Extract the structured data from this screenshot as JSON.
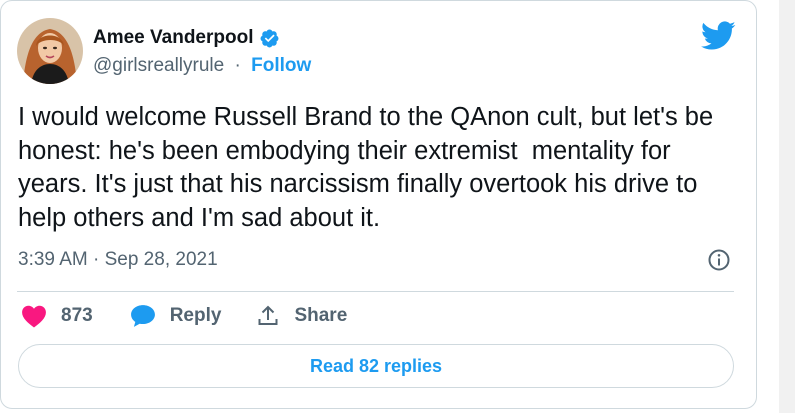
{
  "author": {
    "name": "Amee Vanderpool",
    "handle": "@girlsreallyrule",
    "separator": "·",
    "follow_label": "Follow",
    "verified": true
  },
  "tweet": {
    "text": "I would welcome Russell Brand to the QAnon cult, but let's be honest: he's been embodying their extremist  mentality for years. It's just that his narcissism finally overtook his drive to help others and I'm sad about it.",
    "timestamp": "3:39 AM · Sep 28, 2021"
  },
  "actions": {
    "like_count": "873",
    "reply_label": "Reply",
    "share_label": "Share"
  },
  "read_replies_label": "Read 82 replies",
  "icons": {
    "brand": "twitter-bird-icon",
    "verified": "verified-badge-icon",
    "info": "info-icon",
    "like": "heart-icon",
    "reply": "speech-bubble-icon",
    "share": "share-upload-icon"
  },
  "colors": {
    "accent": "#1d9bf0",
    "like": "#f91880",
    "text": "#0f1419",
    "muted": "#536471",
    "border": "#cfd9de"
  }
}
